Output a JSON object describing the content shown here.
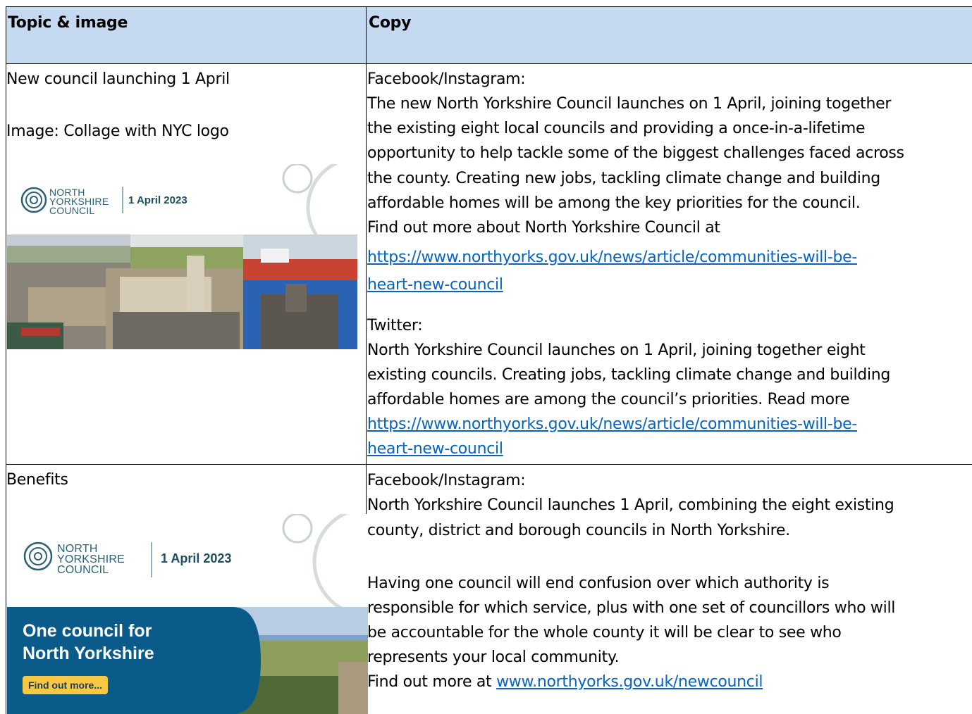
{
  "table": {
    "headers": {
      "topic": "Topic & image",
      "copy": "Copy"
    },
    "rows": [
      {
        "topic": "New council launching 1 April",
        "image_caption": "Image: Collage with NYC logo",
        "image": {
          "logo_lines": [
            "NORTH",
            "YORKSHIRE",
            "COUNCIL"
          ],
          "date": "1 April 2023"
        },
        "copy": {
          "fb_heading": "Facebook/Instagram:",
          "fb_lines": [
            "The new North Yorkshire Council launches on 1 April, joining together",
            "the existing eight local councils and providing a once-in-a-lifetime",
            "opportunity to help tackle some of the biggest challenges faced across",
            "the county. Creating new jobs, tackling climate change and building",
            "affordable homes will be among the key priorities for the council.",
            "Find out more about North Yorkshire Council at"
          ],
          "fb_link_lines": [
            "https://www.northyorks.gov.uk/news/article/communities-will-be-",
            "heart-new-council"
          ],
          "tw_heading": "Twitter:",
          "tw_lines": [
            "North Yorkshire Council launches on 1 April, joining together eight",
            "existing councils. Creating jobs, tackling climate change and building",
            "affordable homes are among the council’s priorities. Read more"
          ],
          "tw_link_lines": [
            "https://www.northyorks.gov.uk/news/article/communities-will-be-",
            "heart-new-council"
          ]
        }
      },
      {
        "topic": "Benefits",
        "image": {
          "logo_lines": [
            "NORTH",
            "YORKSHIRE",
            "COUNCIL"
          ],
          "date": "1 April 2023",
          "promo_title_lines": [
            "One council for",
            "North Yorkshire"
          ],
          "promo_button": "Find out more..."
        },
        "copy": {
          "fb_heading": "Facebook/Instagram:",
          "fb_lines_1": [
            "North Yorkshire Council launches 1 April, combining the eight existing",
            "county, district and borough councils in North Yorkshire."
          ],
          "fb_lines_2": [
            "Having one council will end confusion over which authority is",
            "responsible for which service, plus with one set of councillors who will",
            "be accountable for the whole county it will be clear to see who",
            "represents your local community."
          ],
          "find_out_prefix": "Find out more at ",
          "find_out_link": "www.northyorks.gov.uk/newcouncil"
        }
      }
    ]
  },
  "colors": {
    "header_bg": "#C5D9F1",
    "link": "#0563C1",
    "logo_teal": "#2a5f76",
    "promo_blue": "#0a5b89",
    "promo_button": "#f7c844"
  }
}
